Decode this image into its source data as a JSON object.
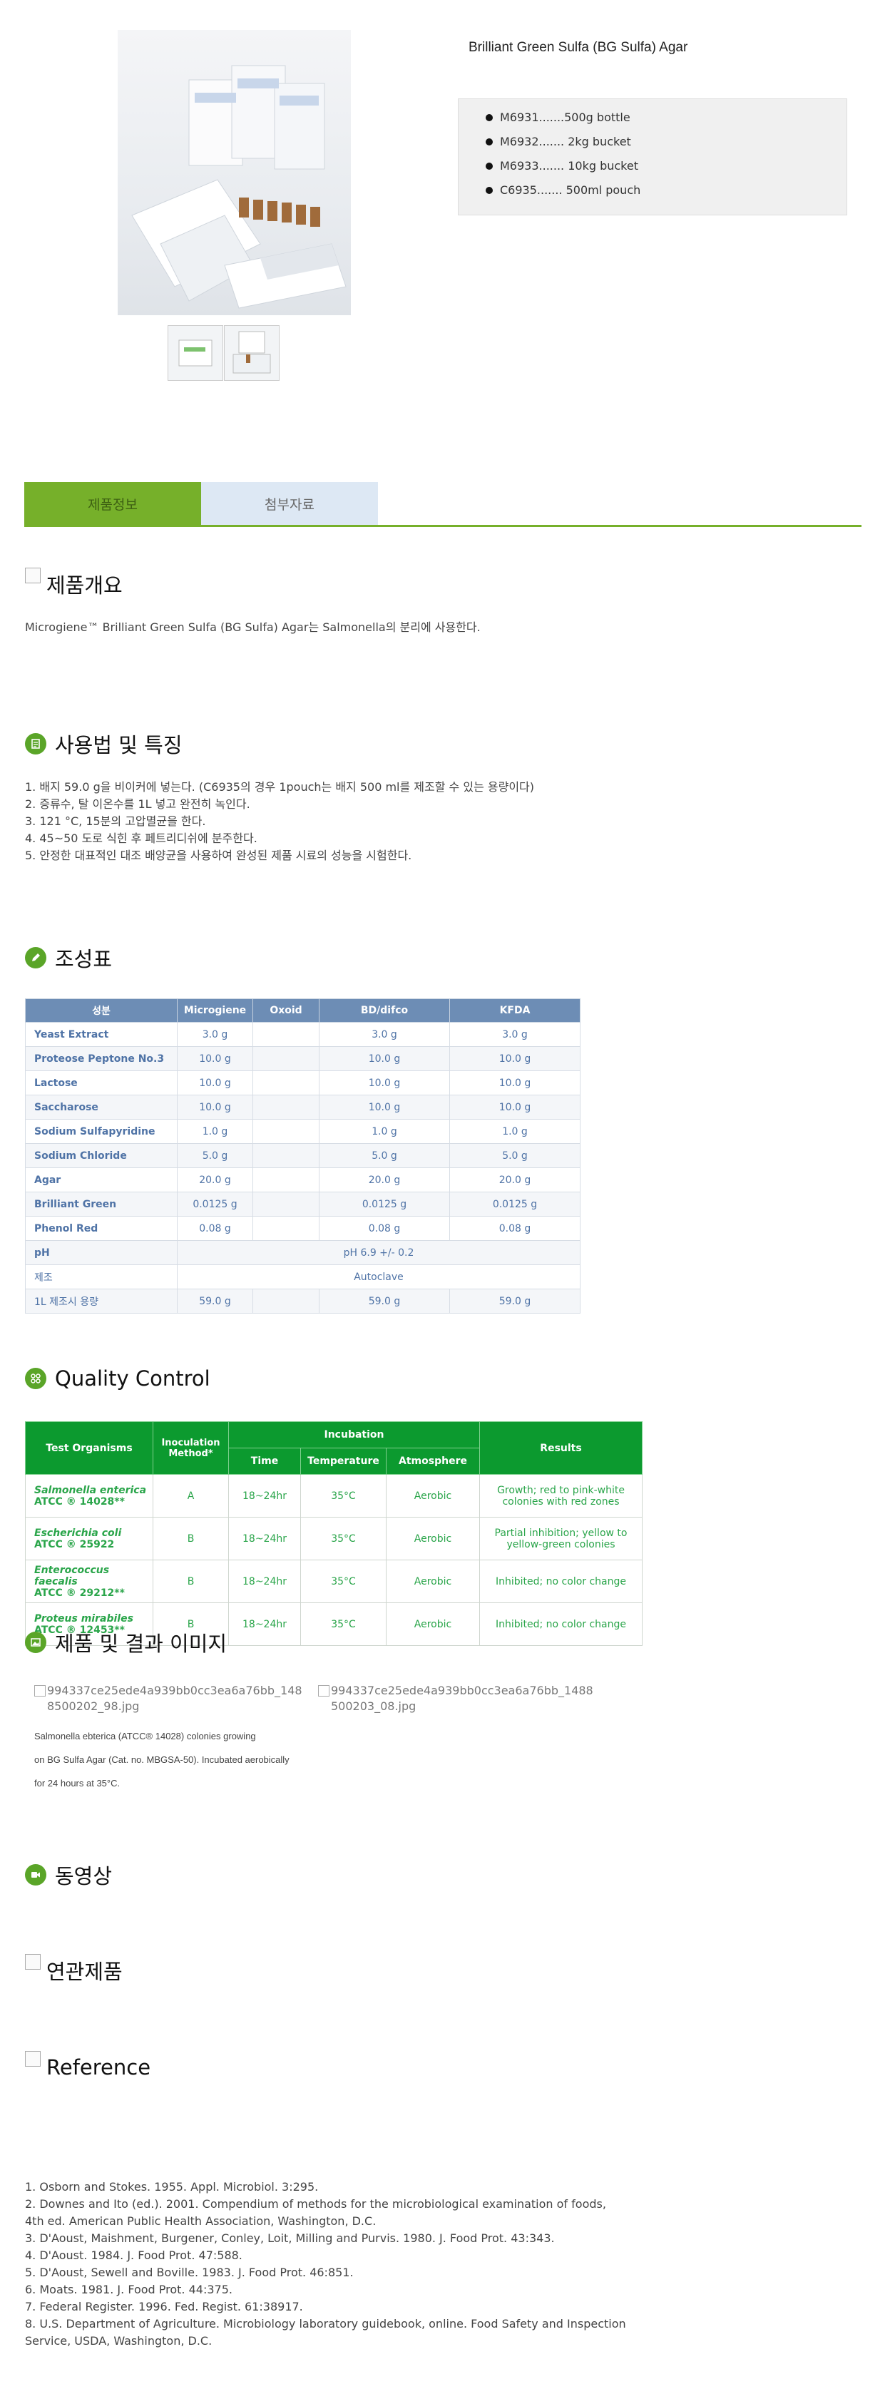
{
  "product": {
    "title": "Brilliant Green Sulfa (BG Sulfa) Agar",
    "skus": [
      "M6931.......500g bottle",
      "M6932....... 2kg bucket",
      "M6933....... 10kg bucket",
      "C6935....... 500ml pouch"
    ]
  },
  "tabs": [
    "제품정보",
    "첨부자료"
  ],
  "overview": {
    "heading": "제품개요",
    "text": "Microgiene™ Brilliant Green Sulfa (BG Sulfa) Agar는 Salmonella의 분리에 사용한다."
  },
  "usage": {
    "heading": "사용법 및 특징",
    "steps": [
      "1. 배지 59.0 g을 비이커에 넣는다. (C6935의 경우 1pouch는 배지 500 ml를 제조할 수 있는 용량이다)",
      "2. 증류수, 탈 이온수를 1L 넣고 완전히 녹인다.",
      "3. 121 °C, 15분의 고압멸균을 한다.",
      "4. 45~50 도로 식힌 후  페트리디쉬에 분주한다.",
      "5. 안정한 대표적인 대조 배양균을 사용하여 완성된 제품 시료의 성능을 시험한다."
    ]
  },
  "composition": {
    "heading": "조성표",
    "headers": [
      "성분",
      "Microgiene",
      "Oxoid",
      "BD/difco",
      "KFDA"
    ],
    "rows": [
      [
        "Yeast Extract",
        "3.0 g",
        "",
        "3.0 g",
        "3.0 g"
      ],
      [
        "Proteose Peptone No.3",
        "10.0 g",
        "",
        "10.0 g",
        "10.0 g"
      ],
      [
        "Lactose",
        "10.0 g",
        "",
        "10.0 g",
        "10.0 g"
      ],
      [
        "Saccharose",
        "10.0 g",
        "",
        "10.0 g",
        "10.0 g"
      ],
      [
        "Sodium Sulfapyridine",
        "1.0 g",
        "",
        "1.0 g",
        "1.0 g"
      ],
      [
        "Sodium Chloride",
        "5.0 g",
        "",
        "5.0 g",
        "5.0 g"
      ],
      [
        "Agar",
        "20.0 g",
        "",
        "20.0 g",
        "20.0 g"
      ],
      [
        "Brilliant Green",
        "0.0125 g",
        "",
        "0.0125 g",
        "0.0125 g"
      ],
      [
        "Phenol Red",
        "0.08 g",
        "",
        "0.08 g",
        "0.08 g"
      ]
    ],
    "ph_label": "pH",
    "ph_value": "pH 6.9 +/- 0.2",
    "sterilize_label": "제조",
    "sterilize_value": "Autoclave",
    "amount_label": "1L 제조시 용량",
    "amount_values": [
      "59.0 g",
      "",
      "59.0 g",
      "59.0 g"
    ]
  },
  "qc": {
    "heading": "Quality Control",
    "headers": {
      "organisms": "Test Organisms",
      "method": "Inoculation Method*",
      "incubation": "Incubation",
      "time": "Time",
      "temperature": "Temperature",
      "atmosphere": "Atmosphere",
      "results": "Results"
    },
    "rows": [
      {
        "name": "Salmonella enterica",
        "atcc": "ATCC ® 14028**",
        "method": "A",
        "time": "18~24hr",
        "temp": "35°C",
        "atm": "Aerobic",
        "result": "Growth; red to pink-white colonies with red zones"
      },
      {
        "name": "Escherichia coli",
        "atcc": "ATCC ® 25922",
        "method": "B",
        "time": "18~24hr",
        "temp": "35°C",
        "atm": "Aerobic",
        "result": "Partial inhibition; yellow to yellow-green colonies"
      },
      {
        "name": "Enterococcus faecalis",
        "atcc": "ATCC ® 29212**",
        "method": "B",
        "time": "18~24hr",
        "temp": "35°C",
        "atm": "Aerobic",
        "result": "Inhibited; no color change"
      },
      {
        "name": "Proteus mirabiles",
        "atcc": "ATCC ® 12453**",
        "method": "B",
        "time": "18~24hr",
        "temp": "35°C",
        "atm": "Aerobic",
        "result": "Inhibited; no color change"
      }
    ]
  },
  "images": {
    "heading": "제품 및 결과 이미지",
    "img1_alt": "994337ce25ede4a939bb0cc3ea6a76bb_1488500202_98.jpg",
    "img2_alt": "994337ce25ede4a939bb0cc3ea6a76bb_1488500203_08.jpg",
    "caption": [
      "Salmonella ebterica (ATCC® 14028) colonies growing",
      "on BG Sulfa Agar (Cat. no. MBGSA-50). Incubated aerobically",
      "for 24 hours at 35°C."
    ]
  },
  "video": {
    "heading": "동영상"
  },
  "related": {
    "heading": "연관제품"
  },
  "reference": {
    "heading": "Reference",
    "items": [
      "1. Osborn and Stokes. 1955. Appl. Microbiol. 3:295.",
      "2. Downes and Ito (ed.). 2001. Compendium of methods for the microbiological examination of foods,",
      "4th ed. American Public Health Association, Washington, D.C.",
      "3. D'Aoust, Maishment, Burgener, Conley, Loit, Milling and Purvis. 1980. J. Food Prot. 43:343.",
      "4. D'Aoust. 1984. J. Food Prot. 47:588.",
      "5. D'Aoust, Sewell and Boville. 1983. J. Food Prot. 46:851.",
      "6. Moats. 1981. J. Food Prot. 44:375.",
      "7. Federal Register. 1996. Fed. Regist. 61:38917.",
      "8. U.S. Department of Agriculture. Microbiology laboratory guidebook, online. Food Safety and Inspection",
      "Service, USDA, Washington, D.C."
    ]
  },
  "colors": {
    "accent_green": "#76b02a",
    "table_blue": "#6d8db5",
    "qc_green": "#0c9a2f"
  }
}
